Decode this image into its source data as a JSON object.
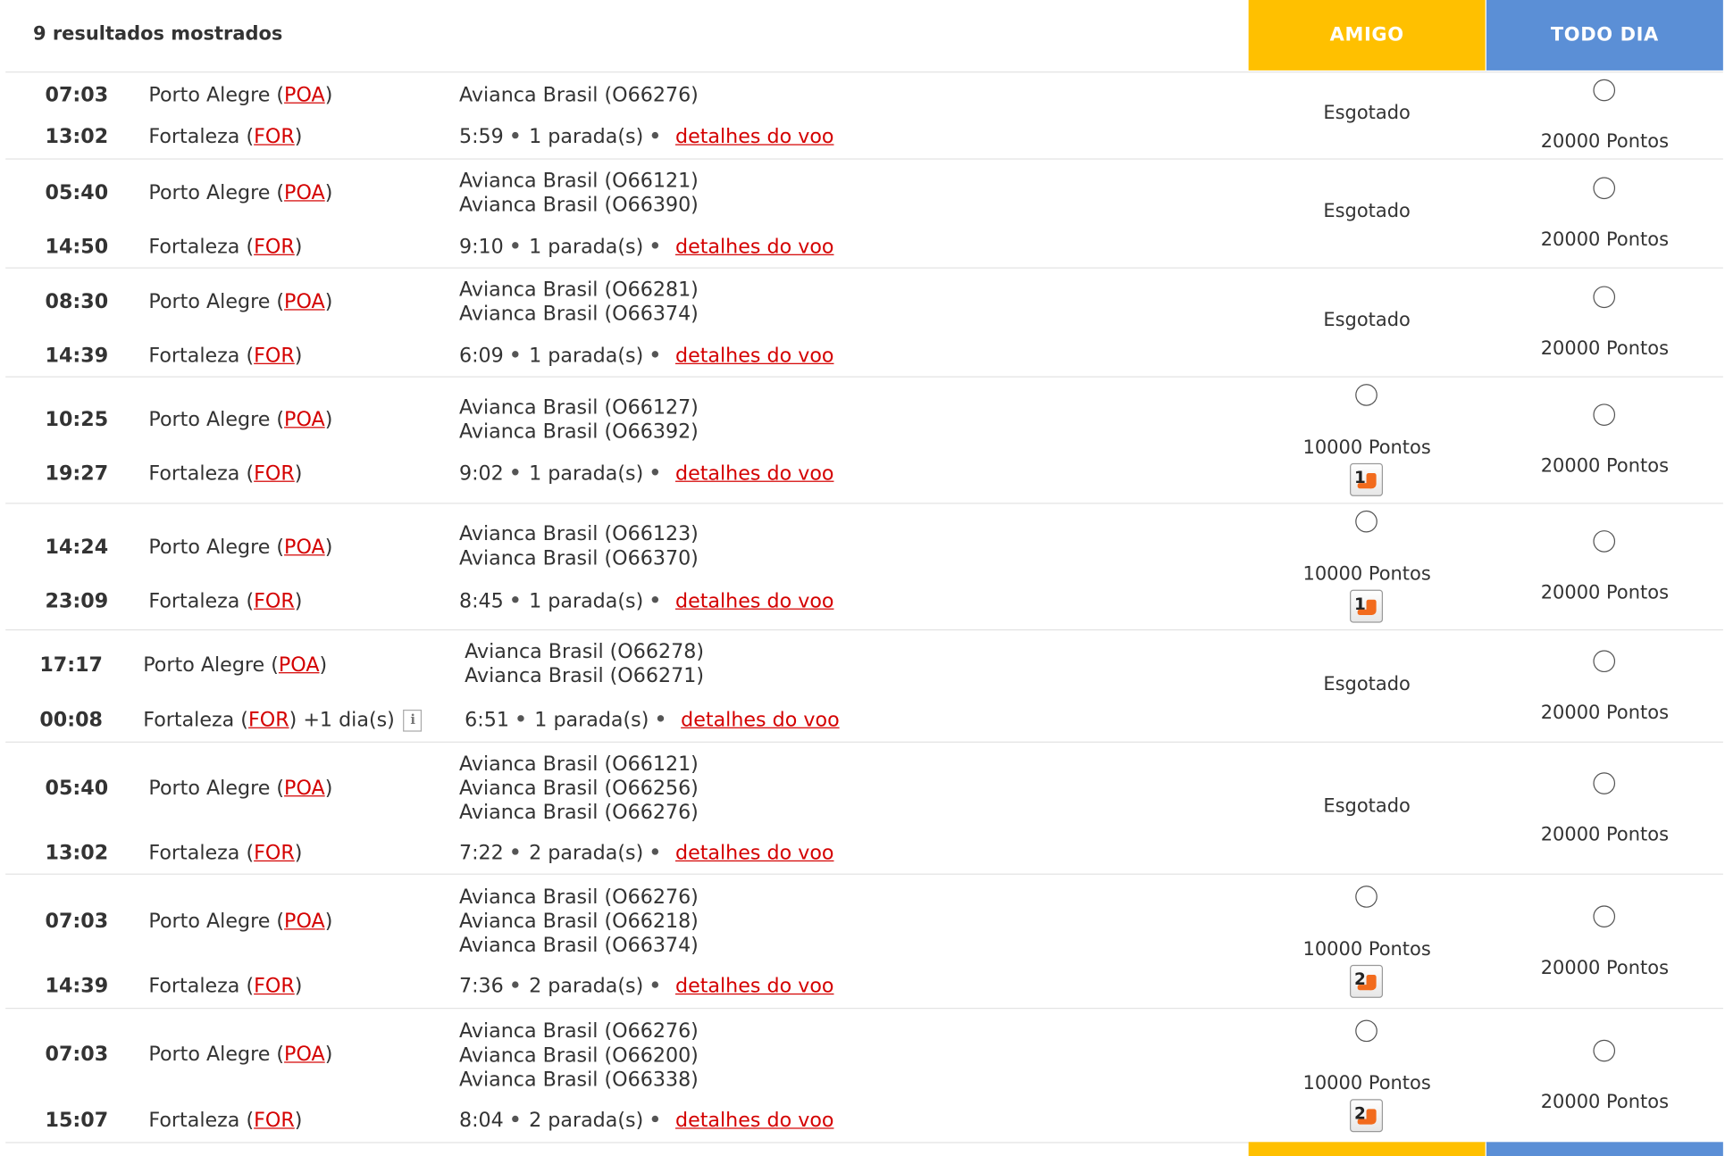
{
  "results_count": "9 resultados mostrados",
  "columns": {
    "amigo": "AMIGO",
    "todo_dia": "TODO DIA"
  },
  "colors": {
    "amigo": "#ffc000",
    "todo_dia": "#5b8fd6",
    "link": "#d40000",
    "seat": "#f26b1d"
  },
  "flights": [
    {
      "dep_time": "07:03",
      "arr_time": "13:02",
      "origin_city": "Porto Alegre",
      "origin_code": "POA",
      "dest_city": "Fortaleza",
      "dest_code": "FOR",
      "airlines": [
        "Avianca Brasil (O66276)"
      ],
      "duration": "5:59",
      "stops": "1 parada(s)",
      "details": "detalhes do voo",
      "amigo": {
        "status": "Esgotado"
      },
      "todo_dia": {
        "points": "20000 Pontos"
      }
    },
    {
      "dep_time": "05:40",
      "arr_time": "14:50",
      "origin_city": "Porto Alegre",
      "origin_code": "POA",
      "dest_city": "Fortaleza",
      "dest_code": "FOR",
      "airlines": [
        "Avianca Brasil (O66121)",
        "Avianca Brasil (O66390)"
      ],
      "duration": "9:10",
      "stops": "1 parada(s)",
      "details": "detalhes do voo",
      "amigo": {
        "status": "Esgotado"
      },
      "todo_dia": {
        "points": "20000 Pontos"
      }
    },
    {
      "dep_time": "08:30",
      "arr_time": "14:39",
      "origin_city": "Porto Alegre",
      "origin_code": "POA",
      "dest_city": "Fortaleza",
      "dest_code": "FOR",
      "airlines": [
        "Avianca Brasil (O66281)",
        "Avianca Brasil (O66374)"
      ],
      "duration": "6:09",
      "stops": "1 parada(s)",
      "details": "detalhes do voo",
      "amigo": {
        "status": "Esgotado"
      },
      "todo_dia": {
        "points": "20000 Pontos"
      }
    },
    {
      "dep_time": "10:25",
      "arr_time": "19:27",
      "origin_city": "Porto Alegre",
      "origin_code": "POA",
      "dest_city": "Fortaleza",
      "dest_code": "FOR",
      "airlines": [
        "Avianca Brasil (O66127)",
        "Avianca Brasil (O66392)"
      ],
      "duration": "9:02",
      "stops": "1 parada(s)",
      "details": "detalhes do voo",
      "amigo": {
        "points": "10000 Pontos",
        "seats": "1"
      },
      "todo_dia": {
        "points": "20000 Pontos"
      }
    },
    {
      "dep_time": "14:24",
      "arr_time": "23:09",
      "origin_city": "Porto Alegre",
      "origin_code": "POA",
      "dest_city": "Fortaleza",
      "dest_code": "FOR",
      "airlines": [
        "Avianca Brasil (O66123)",
        "Avianca Brasil (O66370)"
      ],
      "duration": "8:45",
      "stops": "1 parada(s)",
      "details": "detalhes do voo",
      "amigo": {
        "points": "10000 Pontos",
        "seats": "1"
      },
      "todo_dia": {
        "points": "20000 Pontos"
      }
    },
    {
      "dep_time": "17:17",
      "arr_time": "00:08",
      "origin_city": "Porto Alegre",
      "origin_code": "POA",
      "dest_city": "Fortaleza",
      "dest_code": "FOR",
      "next_day": "+1 dia(s)",
      "airlines": [
        "Avianca Brasil (O66278)",
        "Avianca Brasil (O66271)"
      ],
      "duration": "6:51",
      "stops": "1 parada(s)",
      "details": "detalhes do voo",
      "amigo": {
        "status": "Esgotado"
      },
      "todo_dia": {
        "points": "20000 Pontos"
      }
    },
    {
      "dep_time": "05:40",
      "arr_time": "13:02",
      "origin_city": "Porto Alegre",
      "origin_code": "POA",
      "dest_city": "Fortaleza",
      "dest_code": "FOR",
      "airlines": [
        "Avianca Brasil (O66121)",
        "Avianca Brasil (O66256)",
        "Avianca Brasil (O66276)"
      ],
      "duration": "7:22",
      "stops": "2 parada(s)",
      "details": "detalhes do voo",
      "amigo": {
        "status": "Esgotado"
      },
      "todo_dia": {
        "points": "20000 Pontos"
      }
    },
    {
      "dep_time": "07:03",
      "arr_time": "14:39",
      "origin_city": "Porto Alegre",
      "origin_code": "POA",
      "dest_city": "Fortaleza",
      "dest_code": "FOR",
      "airlines": [
        "Avianca Brasil (O66276)",
        "Avianca Brasil (O66218)",
        "Avianca Brasil (O66374)"
      ],
      "duration": "7:36",
      "stops": "2 parada(s)",
      "details": "detalhes do voo",
      "amigo": {
        "points": "10000 Pontos",
        "seats": "2"
      },
      "todo_dia": {
        "points": "20000 Pontos"
      }
    },
    {
      "dep_time": "07:03",
      "arr_time": "15:07",
      "origin_city": "Porto Alegre",
      "origin_code": "POA",
      "dest_city": "Fortaleza",
      "dest_code": "FOR",
      "airlines": [
        "Avianca Brasil (O66276)",
        "Avianca Brasil (O66200)",
        "Avianca Brasil (O66338)"
      ],
      "duration": "8:04",
      "stops": "2 parada(s)",
      "details": "detalhes do voo",
      "amigo": {
        "points": "10000 Pontos",
        "seats": "2"
      },
      "todo_dia": {
        "points": "20000 Pontos"
      }
    }
  ]
}
